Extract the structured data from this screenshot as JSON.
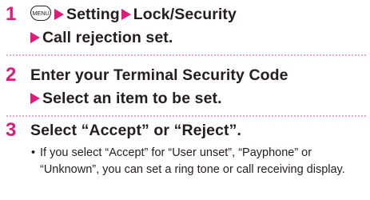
{
  "steps": [
    {
      "number": "1",
      "menu_key": "MENU",
      "line1_items": [
        "Setting",
        "Lock/Security"
      ],
      "line2_item": "Call rejection set."
    },
    {
      "number": "2",
      "line1": "Enter your Terminal Security Code",
      "line2_item": "Select an item to be set."
    },
    {
      "number": "3",
      "line1": "Select “Accept” or “Reject”."
    }
  ],
  "note": {
    "bullet": "•",
    "text": "If you select “Accept” for “User unset”, “Payphone” or “Unknown”, you can set a ring tone or call receiving display."
  },
  "colors": {
    "accent": "#e3197b",
    "divider": "#e8a9c9",
    "text": "#231f20"
  },
  "icons": {
    "step_arrow": "right-triangle-icon",
    "menu_key": "menu-key-icon"
  }
}
